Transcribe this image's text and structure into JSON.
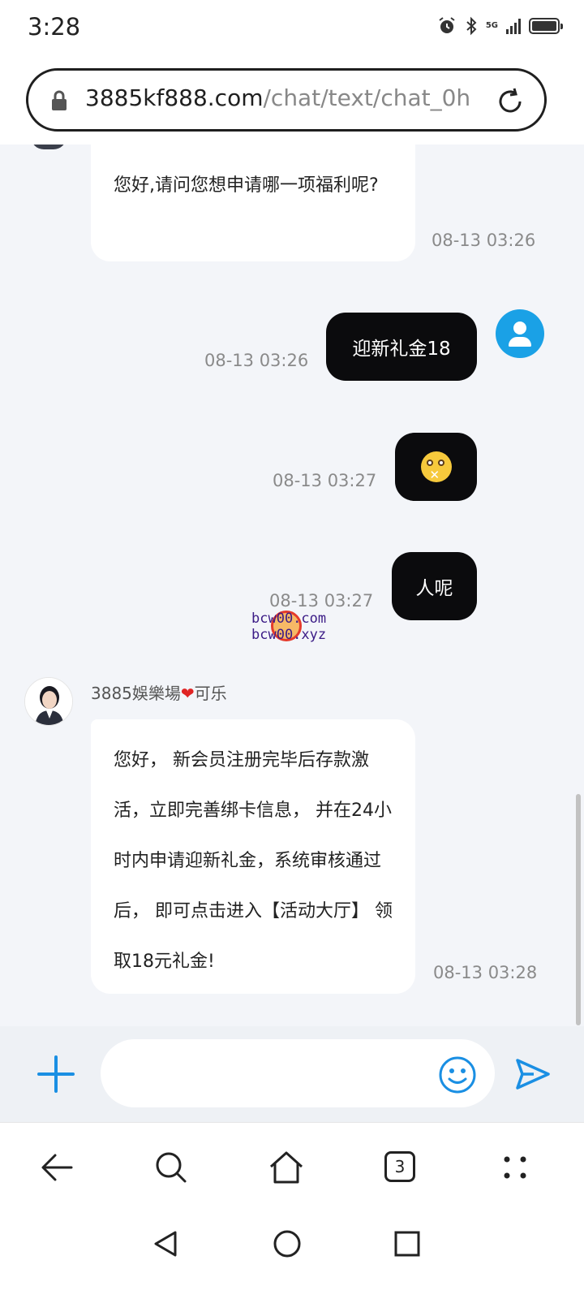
{
  "status_bar": {
    "time": "3:28",
    "network_label": "5G",
    "icons": [
      "alarm-icon",
      "bluetooth-icon",
      "signal-icon",
      "battery-icon"
    ]
  },
  "browser": {
    "url_host": "3885kf888.com",
    "url_path": "/chat/text/chat_0h",
    "tab_count": "3"
  },
  "chat": {
    "messages": [
      {
        "from": "agent",
        "text": "您好,请问您想申请哪一项福利呢?",
        "time": "08-13 03:26"
      },
      {
        "from": "user",
        "text": "迎新礼金18",
        "time": "08-13 03:26"
      },
      {
        "from": "user",
        "emoji": "zipper-mouth-face",
        "time": "08-13 03:27"
      },
      {
        "from": "user",
        "text": "人呢",
        "time": "08-13 03:27"
      },
      {
        "from": "agent",
        "text": "您好， 新会员注册完毕后存款激活，立即完善绑卡信息， 并在24小时内申请迎新礼金，系统审核通过后， 即可点击进入【活动大厅】 领取18元礼金!",
        "time": "08-13 03:28"
      }
    ],
    "agent_name": "3885娛樂場",
    "agent_name_suffix": "可乐",
    "watermark_line1": "bcw00.com",
    "watermark_line2": "bcw00.xyz"
  },
  "input": {
    "placeholder": ""
  },
  "colors": {
    "chat_bg": "#f3f5f9",
    "user_bubble": "#0b0b0d",
    "accent_blue": "#1aa1e6"
  }
}
